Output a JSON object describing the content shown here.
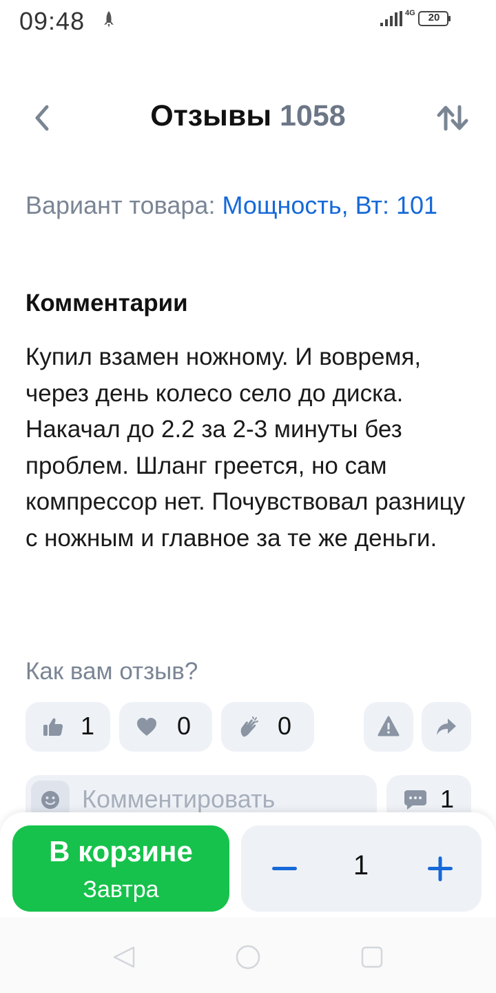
{
  "status_bar": {
    "time": "09:48",
    "network": "4G",
    "battery": "20"
  },
  "header": {
    "title": "Отзывы",
    "count": "1058"
  },
  "variant": {
    "label": "Вариант товара:",
    "value": "Мощность, Вт: 101"
  },
  "comments": {
    "heading": "Комментарии",
    "text": "Купил взамен ножному. И вовремя, через день колесо село до диска. Накачал до 2.2 за 2-3 минуты без проблем. Шланг греется, но сам компрессор нет. Почувствовал разницу с ножным и главное за те же деньги."
  },
  "feedback": {
    "question": "Как вам отзыв?",
    "reactions": [
      {
        "icon": "thumbs-up-icon",
        "count": "1"
      },
      {
        "icon": "heart-icon",
        "count": "0"
      },
      {
        "icon": "clapping-hands-icon",
        "count": "0"
      }
    ]
  },
  "comment_input": {
    "placeholder": "Комментировать",
    "comments_count": "1"
  },
  "cart": {
    "label": "В корзине",
    "delivery": "Завтра",
    "quantity": "1"
  },
  "colors": {
    "accent_blue": "#1669d8",
    "cart_green": "#16c24b",
    "muted": "#7a8594",
    "chip_bg": "#eef1f6"
  }
}
